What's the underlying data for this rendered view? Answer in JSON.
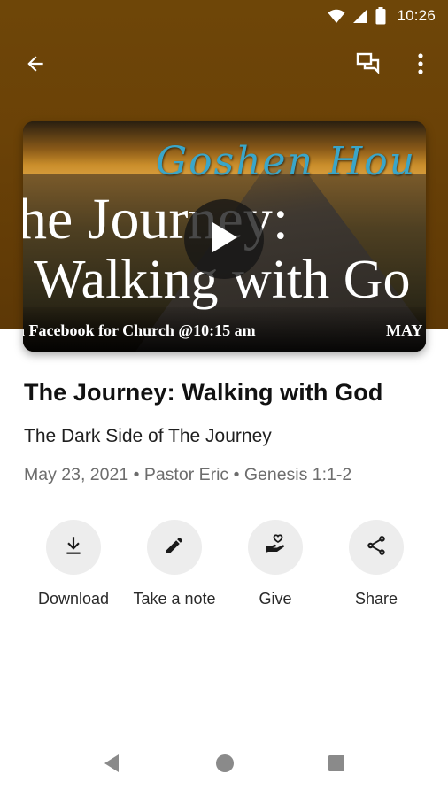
{
  "status_bar": {
    "time": "10:26",
    "icons": [
      "wifi-icon",
      "cellular-signal-icon",
      "battery-icon"
    ]
  },
  "app_bar": {
    "back_icon": "arrow-back-icon",
    "chat_icon": "chat-bubbles-icon",
    "more_icon": "more-vertical-icon"
  },
  "video": {
    "thumbnail_script_text": "Goshen Hou",
    "thumbnail_title_line1": "he Journey:",
    "thumbnail_title_line2": "Walking with Go",
    "thumbnail_footer_left": "n Facebook for Church @10:15 am",
    "thumbnail_footer_right": "MAY",
    "play_icon": "play-icon"
  },
  "sermon": {
    "title": "The Journey: Walking with God",
    "subtitle": "The Dark Side of The Journey",
    "meta": "May 23, 2021 • Pastor Eric • Genesis 1:1-2"
  },
  "actions": [
    {
      "label": "Download",
      "icon": "download-icon"
    },
    {
      "label": "Take a note",
      "icon": "pencil-icon"
    },
    {
      "label": "Give",
      "icon": "heart-hand-icon"
    },
    {
      "label": "Share",
      "icon": "share-icon"
    }
  ],
  "nav_bar": {
    "icons": [
      "nav-back-icon",
      "nav-home-icon",
      "nav-recents-icon"
    ]
  },
  "colors": {
    "hero_brown": "#6b4207",
    "action_circle": "#ededed",
    "meta_gray": "#6d6d6d"
  }
}
